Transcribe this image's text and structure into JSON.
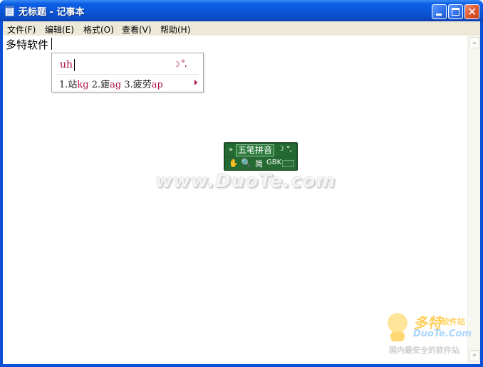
{
  "window": {
    "title": "无标题 - 记事本",
    "app_icon": "notepad-icon",
    "controls": {
      "minimize": "minimize-icon",
      "maximize": "maximize-icon",
      "close": "close-icon",
      "close_glyph": "✕"
    }
  },
  "menu": [
    {
      "label": "文件(F)"
    },
    {
      "label": "编辑(E)"
    },
    {
      "label": "格式(O)"
    },
    {
      "label": "查看(V)"
    },
    {
      "label": "帮助(H)"
    }
  ],
  "editor": {
    "text": "多特软件"
  },
  "ime_popup": {
    "input": "uh",
    "moon_glyph": "☽",
    "punct_glyph": "°,",
    "candidates": [
      {
        "word": "1.站",
        "code": "kg"
      },
      {
        "word": " 2.瘧",
        "code": "ag"
      },
      {
        "word": " 3.疲劳",
        "code": "ap"
      }
    ]
  },
  "ime_status": {
    "fullwidth_toggle": "»",
    "mode": "五笔拼音",
    "moon_glyph": "☽",
    "punct_glyph": "°,",
    "hand_glyph": "✋",
    "search_glyph": "🔍",
    "simplified": "简",
    "charset": "GBK",
    "keyboard_icon": "soft-keyboard-icon"
  },
  "watermarks": {
    "center": "www.DuoTe.com",
    "logo_main": "多特",
    "logo_sub": "软件站",
    "logo_url": "DuoTe.Com",
    "slogan": "国内最安全的软件站"
  },
  "colors": {
    "title_bar": "#0a55d8",
    "ime_code": "#b01040",
    "ime_status_bg": "#1d5a2a"
  }
}
